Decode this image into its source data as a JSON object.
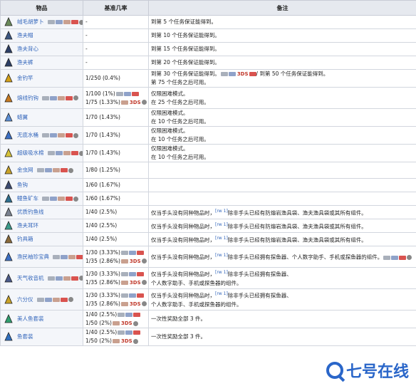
{
  "table": {
    "headers": [
      "物品",
      "基准几率",
      "备注"
    ],
    "rows": [
      {
        "name": "绒毛胡萝卜",
        "plat": [
          "pc",
          "con",
          "mob",
          "sw",
          "cog"
        ],
        "chance": "-",
        "note": "到第 5 个任务保证能得到。",
        "icon": "carrot-icon",
        "icolor": "#6a8a5a"
      },
      {
        "name": "渔夫帽",
        "chance": "-",
        "note": "到第 10 个任务保证能得到。",
        "icon": "hat-icon",
        "icolor": "#3a5580"
      },
      {
        "name": "渔夫背心",
        "chance": "-",
        "note": "到第 15 个任务保证能得到。",
        "icon": "vest-icon",
        "icolor": "#2d3f66"
      },
      {
        "name": "渔夫裤",
        "chance": "-",
        "note": "到第 20 个任务保证能得到。",
        "icon": "pants-icon",
        "icolor": "#2d3f66"
      },
      {
        "name": "金钓竿",
        "chance": "1/250 (0.4%)",
        "note": "到第 30 个任务保证能得到。",
        "note2": "/ 到第 50 个任务保证能得到。",
        "note3": "第 75 个任务之后可用。",
        "icon": "golden-rod-icon",
        "icolor": "#d4a017"
      },
      {
        "name": "熔线钓钩",
        "plat": [
          "pc",
          "con",
          "mob",
          "sw",
          "cog"
        ],
        "chance": "1/100 (1%)",
        "chance2": "1/75 (1.33%)",
        "note": "仅限困难模式。",
        "note3": "在 25 个任务之后可用。",
        "icon": "hook-icon",
        "icolor": "#c77a20"
      },
      {
        "name": "蜡翼",
        "chance": "1/70 (1.43%)",
        "note": "仅限困难模式。",
        "note3": "在 10 个任务之后可用。",
        "icon": "wings-icon",
        "icolor": "#5b8fd6"
      },
      {
        "name": "无底水桶",
        "plat": [
          "pc",
          "con",
          "mob",
          "sw",
          "cog"
        ],
        "chance": "1/70 (1.43%)",
        "note": "仅限困难模式。",
        "note3": "在 10 个任务之后可用。",
        "icon": "bucket-icon",
        "icolor": "#3b6fc4"
      },
      {
        "name": "超级吸水棉",
        "plat": [
          "pc",
          "con",
          "mob",
          "sw",
          "cog"
        ],
        "chance": "1/70 (1.43%)",
        "note": "仅限困难模式。",
        "note3": "在 10 个任务之后可用。",
        "icon": "sponge-icon",
        "icolor": "#d6c23a"
      },
      {
        "name": "金虫网",
        "plat": [
          "pc",
          "con",
          "mob",
          "sw",
          "cog"
        ],
        "chance": "1/80 (1.25%)",
        "note": "",
        "icon": "bug-net-icon",
        "icolor": "#c9a227"
      },
      {
        "name": "鱼钩",
        "chance": "1/60 (1.67%)",
        "note": "",
        "icon": "fish-hook-icon",
        "icolor": "#3b4a70"
      },
      {
        "name": "鳗鱼矿车",
        "plat": [
          "pc",
          "con",
          "mob",
          "sw",
          "cog"
        ],
        "chance": "1/60 (1.67%)",
        "note": "",
        "icon": "minecart-icon",
        "icolor": "#2f6f8f"
      },
      {
        "name": "优质钓鱼线",
        "chance": "1/40 (2.5%)",
        "note": "仅当手头没有同种物品时，",
        "note2": "除非手头已经有防熔岩渔具袋、渔夫渔具袋或其所有组件。",
        "icon": "line-icon",
        "icolor": "#7a8290"
      },
      {
        "name": "渔夫耳环",
        "chance": "1/40 (2.5%)",
        "note": "仅当手头没有同种物品时，",
        "note2": "除非手头已经有防熔岩渔具袋、渔夫渔具袋或其所有组件。",
        "icon": "earring-icon",
        "icolor": "#3a9a8a"
      },
      {
        "name": "钓具箱",
        "chance": "1/40 (2.5%)",
        "note": "仅当手头没有同种物品时，",
        "note2": "除非手头已经有防熔岩渔具袋、渔夫渔具袋或其所有组件。",
        "icon": "tackle-box-icon",
        "icolor": "#8a6a3a"
      },
      {
        "name": "渔民袖珍宝典",
        "plat": [
          "pc",
          "con",
          "mob",
          "sw",
          "cog"
        ],
        "chance": "1/30 (3.33%)",
        "chance2": "1/35 (2.86%)",
        "note": "仅当手头没有同种物品时，",
        "note2": "除非手头已经拥有探鱼器、个人数字助手、手机或探鱼器的组件。",
        "icon": "guide-icon",
        "icolor": "#3b6fc4"
      },
      {
        "name": "天气收音机",
        "plat": [
          "pc",
          "con",
          "mob",
          "sw",
          "cog"
        ],
        "chance": "1/30 (3.33%)",
        "chance2": "1/35 (2.86%)",
        "note": "仅当手头没有同种物品时，",
        "note2": "除非手头已经拥有探鱼器、",
        "note3": "个人数字助手、手机或探鱼器的组件。",
        "icon": "radio-icon",
        "icolor": "#4a5a8a"
      },
      {
        "name": "六分仪",
        "plat": [
          "pc",
          "con",
          "mob",
          "sw",
          "cog"
        ],
        "chance": "1/30 (3.33%)",
        "chance2": "1/35 (2.86%)",
        "note": "仅当手头没有同种物品时，",
        "note2": "除非手头已经拥有探鱼器、",
        "note3": "个人数字助手、手机或探鱼器的组件。",
        "icon": "sextant-icon",
        "icolor": "#c9a227"
      },
      {
        "name": "美人鱼套装",
        "chance": "1/40 (2.5%)",
        "chance2": "1/50 (2%)",
        "note": "一次性奖励全部 3 件。",
        "icon": "mermaid-icon",
        "icolor": "#2f9f6f"
      },
      {
        "name": "鱼套装",
        "chance": "1/40 (2.5%)",
        "chance2": "1/50 (2%)",
        "note": "一次性奖励全部 3 件。",
        "icon": "fish-costume-icon",
        "icolor": "#2f6fbf"
      }
    ]
  },
  "labels": {
    "ref": "[rw 1]",
    "ds": "3DS"
  },
  "watermark": {
    "text": "七号在线"
  }
}
